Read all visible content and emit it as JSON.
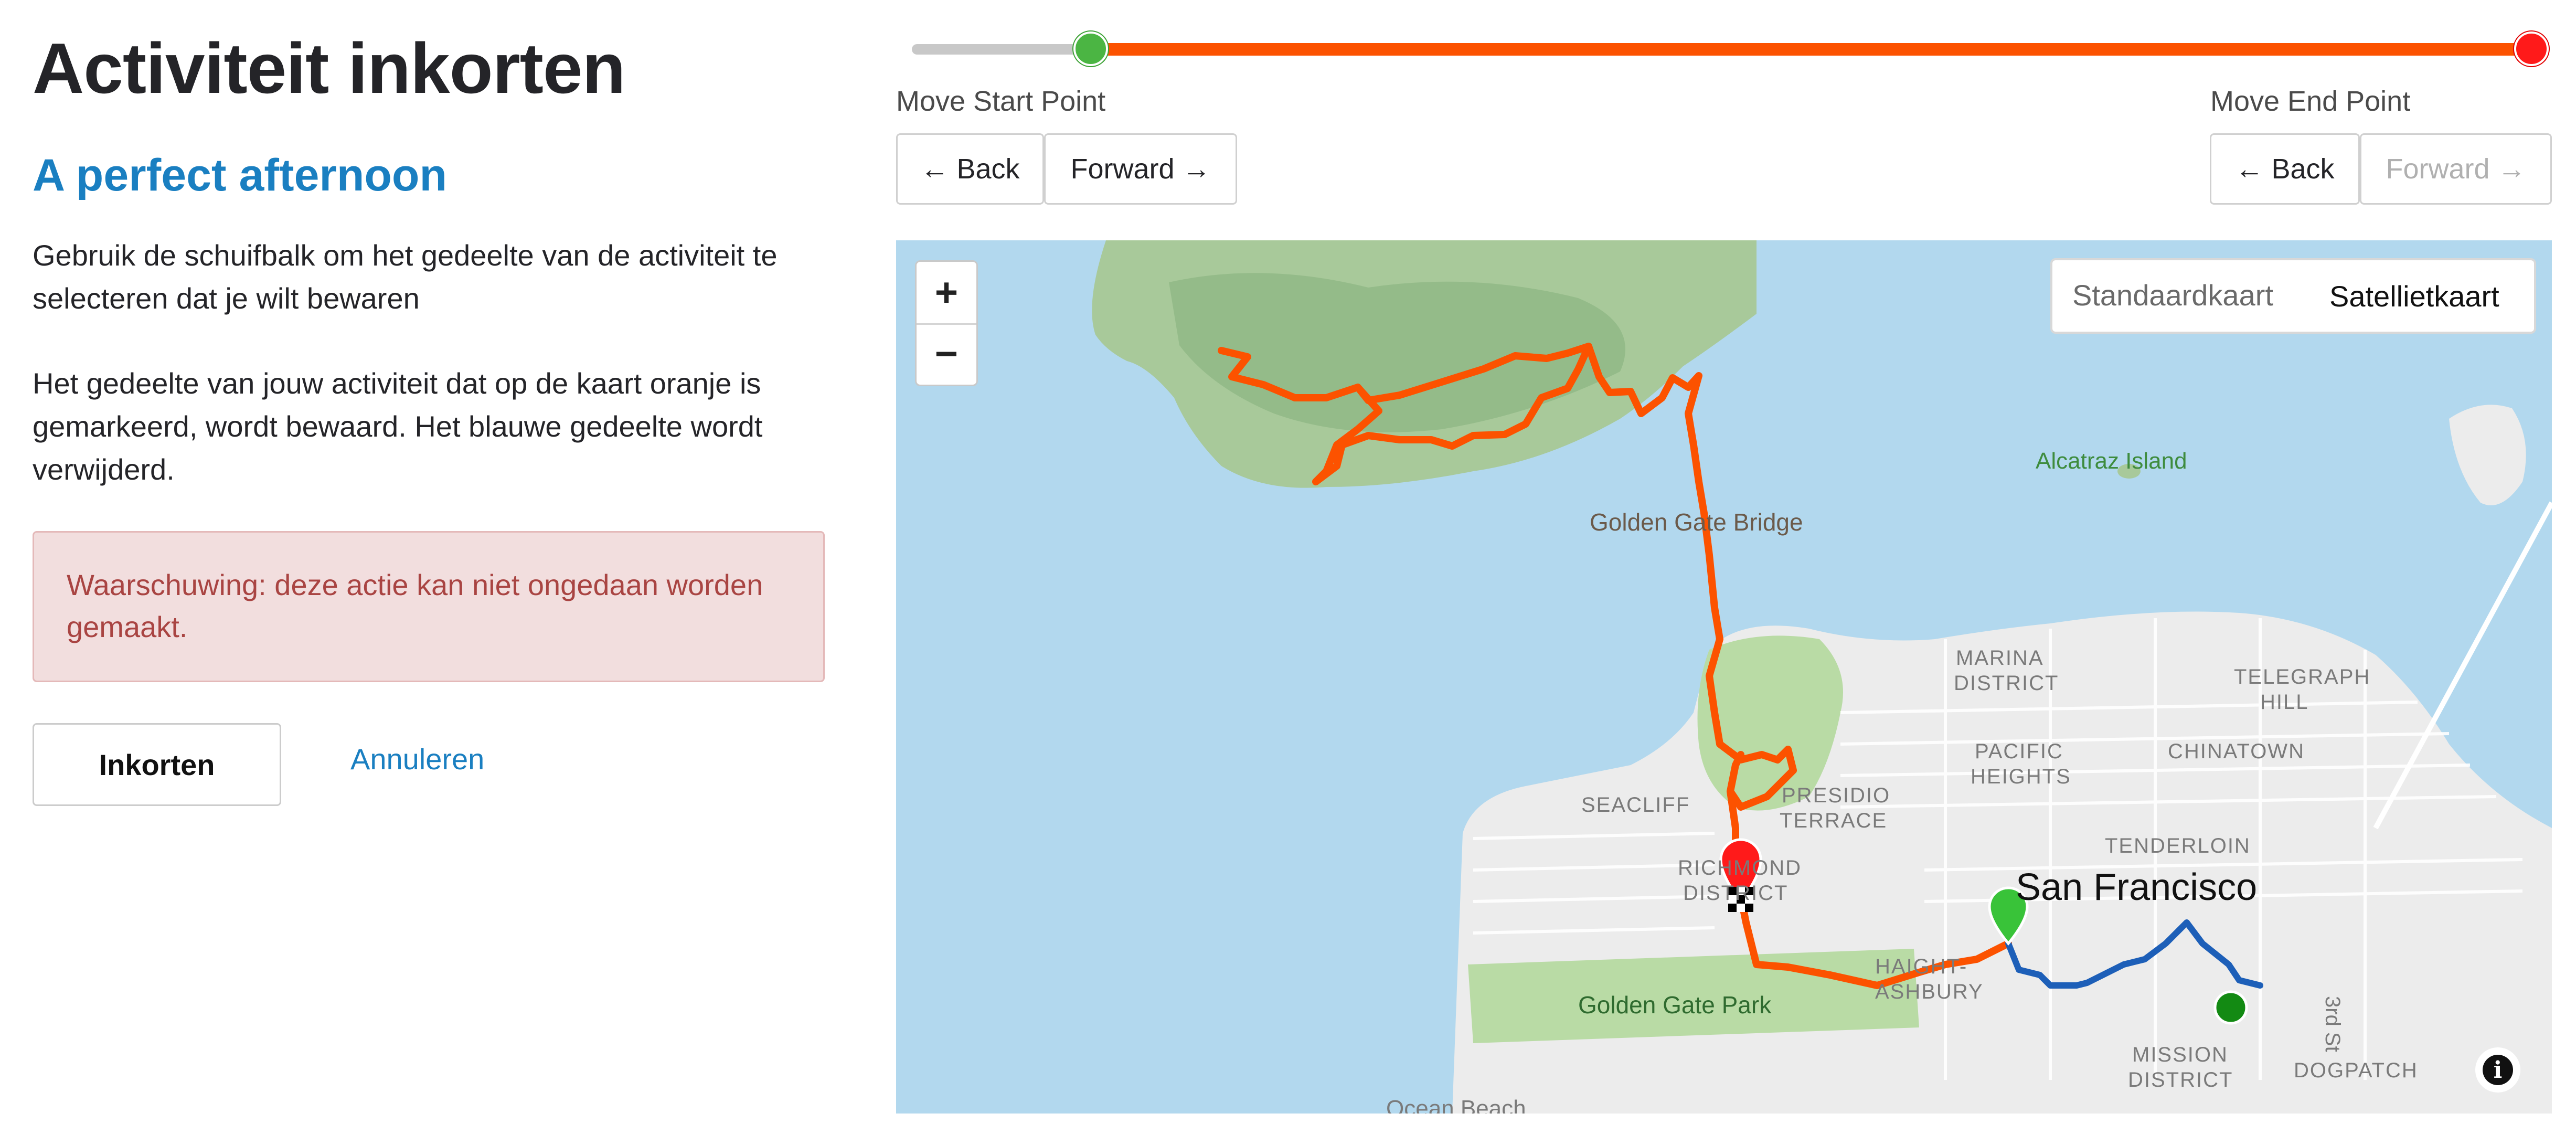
{
  "page": {
    "title": "Activiteit inkorten",
    "activity_name": "A perfect afternoon",
    "instructions": "Gebruik de schuifbalk om het gedeelte van de activiteit te selecteren dat je wilt bewaren",
    "kept_removed_note": "Het gedeelte van jouw activiteit dat op de kaart oranje is gemarkeerd, wordt bewaard. Het blauwe gedeelte wordt verwijderd.",
    "warning": "Waarschuwing: deze actie kan niet ongedaan worden gemaakt.",
    "crop_button": "Inkorten",
    "cancel_link": "Annuleren"
  },
  "slider": {
    "start_fraction": 0.075,
    "end_fraction": 1.0,
    "kept_color": "#fc5200",
    "removed_color": "#c8c8c8",
    "start_handle_color": "#4bb543",
    "end_handle_color": "#ff1a1a"
  },
  "controls": {
    "start_label": "Move Start Point",
    "end_label": "Move End Point",
    "start_back": "← Back",
    "start_forward": "Forward →",
    "end_back": "← Back",
    "end_forward": "Forward →",
    "end_forward_disabled": true
  },
  "map": {
    "zoom_in": "+",
    "zoom_out": "−",
    "map_types": [
      "Standaardkaart",
      "Satellietkaart"
    ],
    "selected_map_type": "Satellietkaart",
    "info_icon": "i",
    "labels": {
      "golden_gate_bridge": "Golden Gate Bridge",
      "alcatraz": "Alcatraz Island",
      "marina_1": "MARINA",
      "marina_2": "DISTRICT",
      "telegraph_1": "TELEGRAPH",
      "telegraph_2": "HILL",
      "pacific_1": "PACIFIC",
      "pacific_2": "HEIGHTS",
      "chinatown": "CHINATOWN",
      "presidio_1": "PRESIDIO",
      "presidio_2": "TERRACE",
      "seacliff": "SEACLIFF",
      "tenderloin": "TENDERLOIN",
      "richmond_1": "RICHMOND",
      "richmond_2": "DISTRICT",
      "san_francisco": "San Francisco",
      "haight_1": "HAIGHT-",
      "haight_2": "ASHBURY",
      "golden_gate_park": "Golden Gate Park",
      "mission_1": "MISSION",
      "mission_2": "DISTRICT",
      "dogpatch": "DOGPATCH",
      "third_st": "3rd St",
      "ocean_beach": "Ocean Beach"
    },
    "kept_route_color": "#fc5200",
    "removed_route_color": "#1d5fb8"
  }
}
